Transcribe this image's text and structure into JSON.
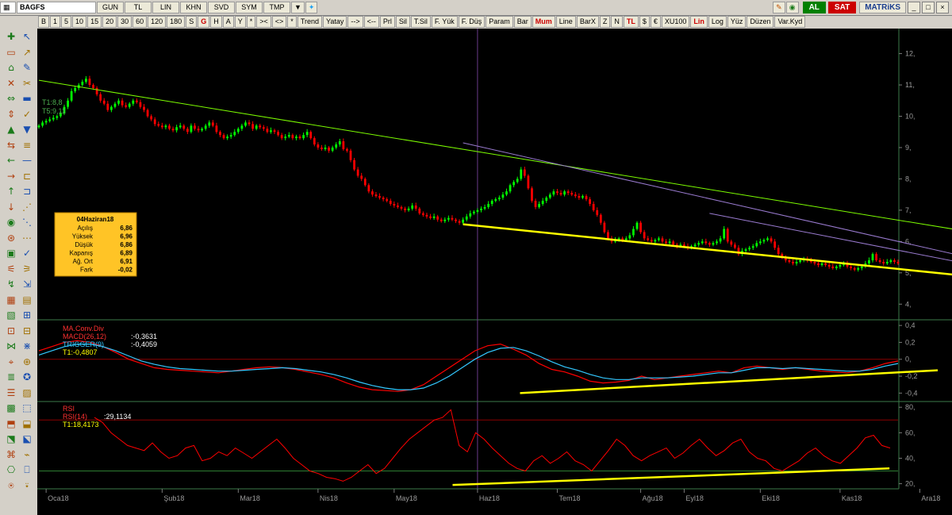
{
  "topbar": {
    "symbol": "BAGFS",
    "menu": [
      "GUN",
      "TL",
      "LIN",
      "KHN",
      "SVD",
      "SYM",
      "TMP"
    ],
    "al_label": "AL",
    "sat_label": "SAT",
    "brand": "MATRiKS"
  },
  "toolbar": {
    "items": [
      "B",
      "1",
      "5",
      "10",
      "15",
      "20",
      "30",
      "60",
      "120",
      "180",
      "S",
      "G",
      "H",
      "A",
      "Y",
      "*",
      "><",
      "<>",
      "*",
      "Trend",
      "Yatay",
      "-->",
      "<--",
      "Prl",
      "Sil",
      "T.Sil",
      "F. Yük",
      "F. Düş",
      "Param",
      "Bar",
      "Mum",
      "Line",
      "BarX",
      "Z",
      "N",
      "TL",
      "$",
      "€",
      "XU100",
      "Lin",
      "Log",
      "Yüz",
      "Düzen",
      "Var.Kyd"
    ],
    "red_items": [
      "G",
      "Mum",
      "TL",
      "Lin"
    ]
  },
  "colors": {
    "background": "#000000",
    "up": "#00ff00",
    "down": "#ff0000",
    "grid": "#4a4a4a",
    "axis": "#3c7a4a",
    "trend_yellow": "#ffff00",
    "trend_green": "#7cfc00",
    "trend_purple": "#9a7bd0",
    "macd": "#ff0000",
    "trigger": "#33c8ff",
    "info_bg": "#ffc426"
  },
  "info_box": {
    "title": "04Haziran18",
    "rows": [
      {
        "label": "Açılış",
        "value": "6,86"
      },
      {
        "label": "Yüksek",
        "value": "6,96"
      },
      {
        "label": "Düşük",
        "value": "6,86"
      },
      {
        "label": "Kapanış",
        "value": "6,89"
      },
      {
        "label": "Ağ. Ort",
        "value": "6,91"
      },
      {
        "label": "Fark",
        "value": "-0,02"
      }
    ]
  },
  "chart_data": [
    {
      "type": "candlestick",
      "title": "",
      "overlay_labels": [
        "T1:8,8",
        "T5:9,11"
      ],
      "ylim": [
        3.5,
        12.8
      ],
      "yticks": [
        4,
        5,
        6,
        7,
        8,
        9,
        10,
        11,
        12
      ],
      "ytick_labels": [
        "4,",
        "5,",
        "6,",
        "7,",
        "8,",
        "9,",
        "10,",
        "11,",
        "12,"
      ],
      "x_months": [
        "Oca18",
        "Şub18",
        "Mar18",
        "Nis18",
        "May18",
        "Haz18",
        "Tem18",
        "Ağu18",
        "Eyl18",
        "Eki18",
        "Kas18",
        "Ara18"
      ],
      "x_month_index": [
        2,
        34,
        55,
        77,
        98,
        121,
        143,
        166,
        178,
        199,
        221,
        243
      ],
      "closes": [
        9.7,
        9.8,
        9.85,
        9.9,
        9.95,
        10.0,
        10.1,
        10.3,
        10.5,
        10.8,
        10.9,
        11.0,
        11.1,
        11.2,
        11.0,
        10.9,
        10.7,
        10.5,
        10.4,
        10.2,
        10.3,
        10.4,
        10.5,
        10.35,
        10.3,
        10.4,
        10.5,
        10.45,
        10.3,
        10.2,
        10.0,
        9.9,
        9.75,
        9.7,
        9.65,
        9.7,
        9.6,
        9.55,
        9.65,
        9.7,
        9.6,
        9.5,
        9.7,
        9.6,
        9.55,
        9.6,
        9.7,
        9.8,
        9.7,
        9.5,
        9.4,
        9.3,
        9.35,
        9.4,
        9.5,
        9.6,
        9.7,
        9.8,
        9.75,
        9.6,
        9.7,
        9.65,
        9.6,
        9.5,
        9.55,
        9.5,
        9.4,
        9.3,
        9.35,
        9.4,
        9.3,
        9.35,
        9.3,
        9.4,
        9.5,
        9.3,
        9.1,
        9.0,
        8.95,
        9.0,
        8.9,
        9.0,
        9.1,
        9.2,
        8.95,
        8.9,
        8.6,
        8.3,
        8.1,
        8.0,
        7.8,
        7.6,
        7.5,
        7.45,
        7.4,
        7.35,
        7.3,
        7.2,
        7.15,
        7.1,
        7.05,
        7.0,
        7.05,
        7.15,
        7.05,
        6.9,
        6.85,
        6.8,
        6.75,
        6.8,
        6.7,
        6.65,
        6.7,
        6.75,
        6.7,
        6.65,
        6.6,
        6.7,
        6.8,
        6.9,
        6.95,
        7.0,
        7.05,
        7.1,
        7.2,
        7.3,
        7.35,
        7.4,
        7.5,
        7.6,
        7.8,
        7.9,
        8.0,
        8.3,
        8.1,
        7.7,
        7.3,
        7.1,
        7.2,
        7.3,
        7.4,
        7.5,
        7.6,
        7.55,
        7.5,
        7.6,
        7.55,
        7.5,
        7.45,
        7.4,
        7.45,
        7.35,
        7.2,
        7.0,
        6.85,
        6.6,
        6.3,
        6.1,
        6.0,
        6.05,
        6.1,
        6.05,
        6.1,
        6.2,
        6.4,
        6.6,
        6.3,
        6.1,
        6.05,
        6.0,
        6.05,
        6.1,
        6.0,
        5.95,
        6.0,
        5.9,
        5.85,
        5.9,
        5.85,
        5.8,
        5.85,
        5.9,
        5.95,
        6.0,
        5.95,
        5.9,
        5.95,
        6.0,
        6.1,
        6.4,
        6.0,
        5.9,
        5.8,
        5.6,
        5.7,
        5.75,
        5.8,
        5.85,
        5.95,
        6.0,
        6.05,
        6.1,
        6.0,
        5.8,
        5.6,
        5.5,
        5.4,
        5.35,
        5.3,
        5.35,
        5.4,
        5.45,
        5.4,
        5.35,
        5.3,
        5.25,
        5.3,
        5.25,
        5.2,
        5.15,
        5.2,
        5.25,
        5.3,
        5.2,
        5.15,
        5.1,
        5.15,
        5.2,
        5.3,
        5.4,
        5.6,
        5.4,
        5.35,
        5.3,
        5.35,
        5.4,
        5.35,
        5.3
      ],
      "trendlines": [
        {
          "color": "yellow",
          "points": [
            [
              117,
              6.55
            ],
            [
              260,
              4.85
            ]
          ]
        },
        {
          "color": "green",
          "points": [
            [
              0,
              11.15
            ],
            [
              260,
              6.25
            ]
          ]
        },
        {
          "color": "purple",
          "points": [
            [
              117,
              9.15
            ],
            [
              260,
              5.4
            ]
          ]
        },
        {
          "color": "purple",
          "points": [
            [
              185,
              6.9
            ],
            [
              260,
              5.2
            ]
          ]
        }
      ],
      "cursor_index": 121
    },
    {
      "type": "line",
      "title": "MA.Conv.Div",
      "series": [
        {
          "name": "MACD(26,12)",
          "display": ":-0,3631",
          "color": "#ff0000",
          "values": [
            0.1,
            0.15,
            0.2,
            0.22,
            0.2,
            0.15,
            0.08,
            0.0,
            -0.05,
            -0.1,
            -0.12,
            -0.13,
            -0.14,
            -0.15,
            -0.16,
            -0.14,
            -0.12,
            -0.1,
            -0.09,
            -0.1,
            -0.12,
            -0.15,
            -0.18,
            -0.22,
            -0.28,
            -0.33,
            -0.36,
            -0.37,
            -0.38,
            -0.36,
            -0.3,
            -0.2,
            -0.1,
            0.0,
            0.1,
            0.16,
            0.18,
            0.12,
            0.05,
            -0.05,
            -0.12,
            -0.15,
            -0.2,
            -0.26,
            -0.28,
            -0.27,
            -0.25,
            -0.2,
            -0.24,
            -0.22,
            -0.2,
            -0.18,
            -0.16,
            -0.14,
            -0.16,
            -0.1,
            -0.08,
            -0.1,
            -0.12,
            -0.1,
            -0.12,
            -0.14,
            -0.15,
            -0.16,
            -0.14,
            -0.1,
            -0.05,
            -0.02
          ]
        },
        {
          "name": "TRIGGER(9)",
          "display": ":-0,4059",
          "color": "#33c8ff",
          "values": [
            0.05,
            0.1,
            0.15,
            0.18,
            0.18,
            0.15,
            0.1,
            0.04,
            -0.02,
            -0.06,
            -0.09,
            -0.11,
            -0.12,
            -0.13,
            -0.14,
            -0.14,
            -0.13,
            -0.12,
            -0.11,
            -0.1,
            -0.11,
            -0.13,
            -0.15,
            -0.18,
            -0.22,
            -0.27,
            -0.31,
            -0.34,
            -0.36,
            -0.36,
            -0.34,
            -0.28,
            -0.2,
            -0.1,
            0.0,
            0.08,
            0.13,
            0.14,
            0.1,
            0.04,
            -0.03,
            -0.09,
            -0.13,
            -0.18,
            -0.22,
            -0.24,
            -0.24,
            -0.22,
            -0.22,
            -0.22,
            -0.21,
            -0.2,
            -0.18,
            -0.16,
            -0.16,
            -0.13,
            -0.1,
            -0.1,
            -0.11,
            -0.1,
            -0.11,
            -0.12,
            -0.13,
            -0.14,
            -0.14,
            -0.12,
            -0.08,
            -0.05
          ]
        }
      ],
      "overlay_labels": [
        "T1:-0,4807"
      ],
      "ylim": [
        -0.5,
        0.42
      ],
      "yticks": [
        -0.4,
        -0.2,
        0,
        0.2,
        0.4
      ],
      "ytick_labels": [
        "-0,4",
        "-0,2",
        "0,",
        "0,2",
        "0,4"
      ],
      "trendline": [
        [
          0.56,
          -0.4
        ],
        [
          1.0,
          -0.15
        ]
      ]
    },
    {
      "type": "line",
      "title": "RSI",
      "series": [
        {
          "name": "RSI(14)",
          "display": ":29,1134",
          "color": "#ff0000",
          "values": [
            72,
            68,
            60,
            55,
            50,
            48,
            46,
            52,
            45,
            40,
            42,
            48,
            50,
            38,
            40,
            45,
            42,
            48,
            44,
            40,
            45,
            50,
            55,
            48,
            40,
            35,
            30,
            28,
            25,
            24,
            22,
            25,
            30,
            35,
            28,
            32,
            40,
            48,
            55,
            60,
            65,
            70,
            72,
            78,
            50,
            45,
            60,
            55,
            48,
            42,
            36,
            32,
            30,
            38,
            42,
            36,
            40,
            45,
            38,
            35,
            30,
            38,
            46,
            55,
            50,
            42,
            38,
            42,
            45,
            48,
            40,
            44,
            50,
            55,
            48,
            42,
            46,
            52,
            55,
            45,
            40,
            38,
            32,
            30,
            34,
            38,
            44,
            48,
            42,
            38,
            36,
            42,
            48,
            56,
            58,
            50,
            48
          ]
        }
      ],
      "overlay_labels": [
        "T1:18,4173"
      ],
      "ylim": [
        16,
        82
      ],
      "yticks": [
        20,
        40,
        60,
        80
      ],
      "ytick_labels": [
        "20,",
        "40,",
        "60,",
        "80,"
      ],
      "reference_lines": [
        30,
        70
      ],
      "trendline": [
        [
          0.5,
          19
        ],
        [
          0.99,
          32
        ]
      ]
    }
  ]
}
